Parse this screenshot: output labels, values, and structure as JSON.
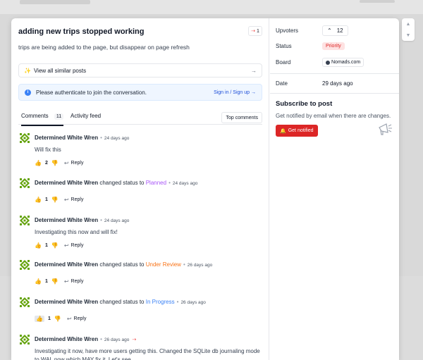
{
  "post": {
    "title": "adding new trips stopped working",
    "share_count": "1",
    "description": "trips are being added to the page, but disappear on page refresh"
  },
  "similar": {
    "label": "View all similar posts"
  },
  "auth": {
    "message": "Please authenticate to join the conversation.",
    "link": "Sign in / Sign up →"
  },
  "tabs": {
    "comments_label": "Comments",
    "comments_count": "11",
    "activity_label": "Activity feed",
    "sort_label": "Top comments"
  },
  "comments": [
    {
      "author": "Determined White Wren",
      "time": "24 days ago",
      "body": "Will fix this",
      "votes": "2",
      "reply": "Reply"
    },
    {
      "author": "Determined White Wren",
      "verb": "changed status to",
      "status": "Planned",
      "status_color": "#a855f7",
      "time": "24 days ago",
      "votes": "1",
      "reply": "Reply"
    },
    {
      "author": "Determined White Wren",
      "time": "24 days ago",
      "body": "Investigating this now and will fix!",
      "votes": "1",
      "reply": "Reply"
    },
    {
      "author": "Determined White Wren",
      "verb": "changed status to",
      "status": "Under Review",
      "status_color": "#f97316",
      "time": "26 days ago",
      "votes": "1",
      "reply": "Reply"
    },
    {
      "author": "Determined White Wren",
      "verb": "changed status to",
      "status": "In Progress",
      "status_color": "#3b82f6",
      "time": "26 days ago",
      "votes": "1",
      "reply": "Reply"
    },
    {
      "author": "Determined White Wren",
      "time": "26 days ago",
      "body": "Investigating it now, have more users getting this. Changed the SQLite db journaling mode to WAL now which MAY fix it. Let's see"
    }
  ],
  "sidebar": {
    "upvoters_label": "Upvoters",
    "upvoters_count": "12",
    "status_label": "Status",
    "status_value": "Priority",
    "board_label": "Board",
    "board_value": "Nomads.com",
    "date_label": "Date",
    "date_value": "29 days ago",
    "subscribe_title": "Subscribe to post",
    "subscribe_desc": "Get notified by email when there are changes.",
    "notify_label": "Get notified"
  },
  "colors": {
    "accent_red": "#dc2626",
    "info_blue": "#3b82f6"
  }
}
